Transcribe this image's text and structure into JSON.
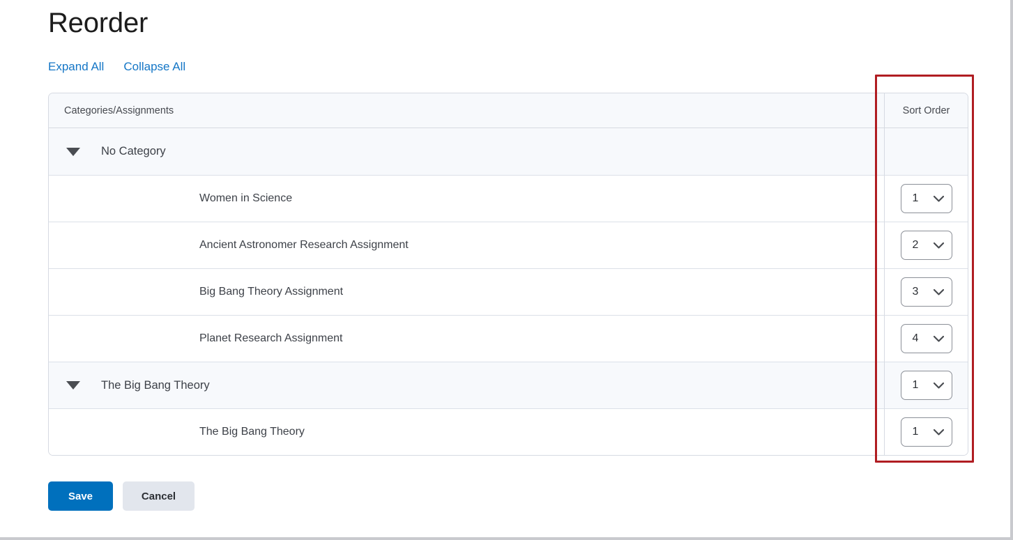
{
  "page": {
    "title": "Reorder"
  },
  "actions": {
    "expand_all": "Expand All",
    "collapse_all": "Collapse All"
  },
  "table": {
    "headers": {
      "name": "Categories/Assignments",
      "sort_order": "Sort Order"
    },
    "rows": [
      {
        "type": "category",
        "label": "No Category",
        "sort_order": ""
      },
      {
        "type": "assignment",
        "label": "Women in Science",
        "sort_order": "1"
      },
      {
        "type": "assignment",
        "label": "Ancient Astronomer Research Assignment",
        "sort_order": "2"
      },
      {
        "type": "assignment",
        "label": "Big Bang Theory Assignment",
        "sort_order": "3"
      },
      {
        "type": "assignment",
        "label": "Planet Research Assignment",
        "sort_order": "4"
      },
      {
        "type": "category",
        "label": "The Big Bang Theory",
        "sort_order": "1"
      },
      {
        "type": "assignment",
        "label": "The Big Bang Theory",
        "sort_order": "1"
      }
    ]
  },
  "footer": {
    "save_label": "Save",
    "cancel_label": "Cancel"
  },
  "annotation": {
    "color": "#b01d22",
    "target": "sort-order-column"
  },
  "colors": {
    "link": "#1476c6",
    "primary_button": "#0070bd",
    "secondary_button": "#e2e6ed",
    "category_row_bg": "#f7f9fc",
    "table_border": "#d6dae2",
    "highlight": "#b01d22"
  },
  "icons": {
    "caret": "caret-down-icon",
    "chevron": "chevron-down-icon"
  }
}
